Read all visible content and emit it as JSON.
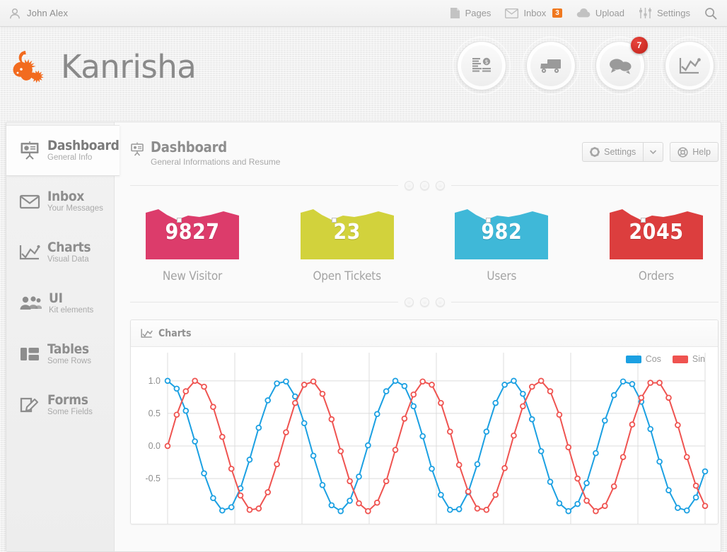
{
  "topbar": {
    "user_name": "John Alex",
    "user_icon": "user-icon",
    "items": [
      {
        "label": "Pages",
        "icon": "page-icon"
      },
      {
        "label": "Inbox",
        "icon": "envelope-icon",
        "badge": "3"
      },
      {
        "label": "Upload",
        "icon": "cloud-upload-icon"
      },
      {
        "label": "Settings",
        "icon": "sliders-icon"
      }
    ],
    "search_icon": "search-icon"
  },
  "brand": {
    "name": "Kanrisha",
    "logo_icon": "lizard-logo-icon",
    "logo_color": "#f26b1f"
  },
  "nav_circles": [
    {
      "icon": "coins-money-icon",
      "name": "finance"
    },
    {
      "icon": "truck-icon",
      "name": "shipping"
    },
    {
      "icon": "chat-bubbles-icon",
      "name": "messages",
      "badge": "7"
    },
    {
      "icon": "line-chart-icon",
      "name": "analytics"
    }
  ],
  "sidebar": {
    "items": [
      {
        "title": "Dashboard",
        "subtitle": "General Info",
        "icon": "presentation-icon",
        "active": true
      },
      {
        "title": "Inbox",
        "subtitle": "Your Messages",
        "icon": "envelope-icon",
        "active": false
      },
      {
        "title": "Charts",
        "subtitle": "Visual Data",
        "icon": "line-chart-icon",
        "active": false
      },
      {
        "title": "UI",
        "subtitle": "Kit elements",
        "icon": "users-group-icon",
        "active": false
      },
      {
        "title": "Tables",
        "subtitle": "Some Rows",
        "icon": "table-grid-icon",
        "active": false
      },
      {
        "title": "Forms",
        "subtitle": "Some Fields",
        "icon": "pencil-square-icon",
        "active": false
      }
    ]
  },
  "page_header": {
    "icon": "presentation-icon",
    "title": "Dashboard",
    "subtitle": "General Informations and Resume",
    "settings_label": "Settings",
    "settings_icon": "gear-icon",
    "caret_icon": "chevron-down-icon",
    "help_label": "Help",
    "help_icon": "lifebuoy-icon"
  },
  "stat_cards": [
    {
      "value": "9827",
      "caption": "New Visitor",
      "color": "#dc3c6b"
    },
    {
      "value": "23",
      "caption": "Open Tickets",
      "color": "#d2d23c"
    },
    {
      "value": "982",
      "caption": "Users",
      "color": "#3fb8d8"
    },
    {
      "value": "2045",
      "caption": "Orders",
      "color": "#dc3e3e"
    }
  ],
  "chart_panel": {
    "title": "Charts",
    "icon": "line-chart-icon"
  },
  "chart_data": {
    "type": "line",
    "title": "Charts",
    "xlabel": "",
    "ylabel": "",
    "ylim": [
      -1.15,
      1.15
    ],
    "xlim": [
      0,
      60
    ],
    "grid": true,
    "legend_position": "top-right",
    "yticks": [
      "1.0",
      "0.5",
      "0.0",
      "-0.5"
    ],
    "ytick_values": [
      1.0,
      0.5,
      0.0,
      -0.5
    ],
    "markers": "circle",
    "x": [
      0,
      1,
      2,
      3,
      4,
      5,
      6,
      7,
      8,
      9,
      10,
      11,
      12,
      13,
      14,
      15,
      16,
      17,
      18,
      19,
      20,
      21,
      22,
      23,
      24,
      25,
      26,
      27,
      28,
      29,
      30,
      31,
      32,
      33,
      34,
      35,
      36,
      37,
      38,
      39,
      40,
      41,
      42,
      43,
      44,
      45,
      46,
      47,
      48,
      49,
      50,
      51,
      52,
      53,
      54,
      55,
      56,
      57,
      58,
      59
    ],
    "series": [
      {
        "name": "Cos",
        "color": "#1ba0e2",
        "values": [
          1.0,
          0.88,
          0.54,
          0.07,
          -0.42,
          -0.8,
          -0.99,
          -0.94,
          -0.65,
          -0.21,
          0.28,
          0.7,
          0.96,
          0.99,
          0.76,
          0.35,
          -0.15,
          -0.6,
          -0.91,
          -1.0,
          -0.84,
          -0.47,
          0.01,
          0.49,
          0.84,
          1.0,
          0.92,
          0.61,
          0.15,
          -0.35,
          -0.75,
          -0.98,
          -0.97,
          -0.71,
          -0.28,
          0.22,
          0.66,
          0.94,
          1.0,
          0.8,
          0.41,
          -0.08,
          -0.55,
          -0.88,
          -1.0,
          -0.89,
          -0.57,
          -0.11,
          0.39,
          0.78,
          0.99,
          0.95,
          0.68,
          0.26,
          -0.24,
          -0.68,
          -0.95,
          -0.99,
          -0.79,
          -0.39
        ]
      },
      {
        "name": "Sin",
        "color": "#ef5350",
        "values": [
          0.0,
          0.48,
          0.84,
          1.0,
          0.91,
          0.6,
          0.14,
          -0.35,
          -0.76,
          -0.98,
          -0.96,
          -0.71,
          -0.28,
          0.21,
          0.66,
          0.94,
          0.99,
          0.8,
          0.41,
          -0.08,
          -0.54,
          -0.88,
          -1.0,
          -0.87,
          -0.54,
          -0.06,
          0.42,
          0.79,
          0.99,
          0.94,
          0.66,
          0.22,
          -0.29,
          -0.7,
          -0.96,
          -0.98,
          -0.75,
          -0.34,
          0.16,
          0.61,
          0.91,
          1.0,
          0.84,
          0.48,
          -0.02,
          -0.5,
          -0.84,
          -1.0,
          -0.92,
          -0.62,
          -0.17,
          0.33,
          0.74,
          0.97,
          0.97,
          0.74,
          0.32,
          -0.17,
          -0.61,
          -0.92
        ]
      }
    ]
  }
}
